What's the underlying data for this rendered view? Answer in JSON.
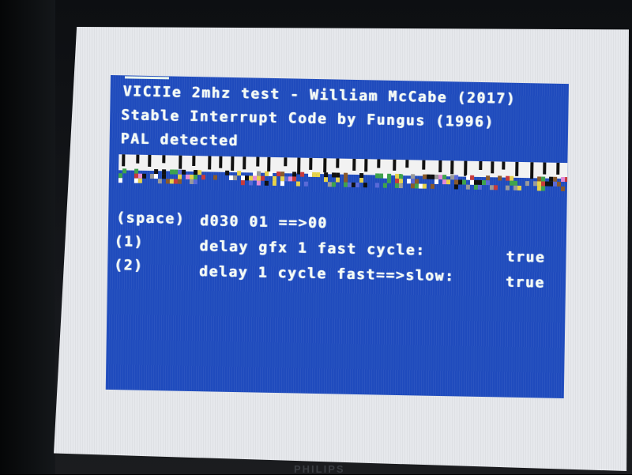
{
  "screen": {
    "title": "VICIIe 2mhz test - William McCabe (2017)",
    "credit": "Stable Interrupt Code by Fungus (1996)",
    "status": "PAL detected",
    "menu": [
      {
        "key": "(space)",
        "label": "d030 01 ==>00",
        "value": ""
      },
      {
        "key": "(1)",
        "label": "delay gfx 1 fast cycle:",
        "value": "true"
      },
      {
        "key": "(2)",
        "label": "delay 1 cycle fast==>slow:",
        "value": "true"
      }
    ]
  },
  "monitor": {
    "brand": "PHILIPS"
  },
  "colors": {
    "c64_blue": "#1f4bbd",
    "text": "#f4fbf5",
    "screen_bezel": "#e6e8ec"
  }
}
